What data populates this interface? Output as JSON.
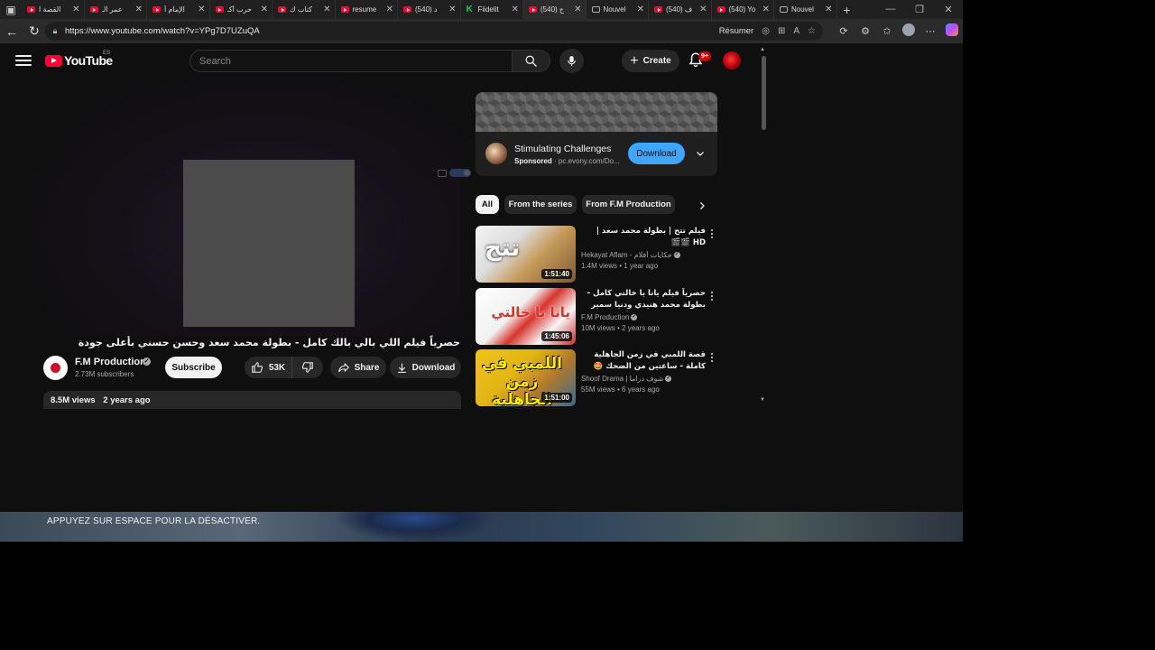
{
  "browser": {
    "tabs": [
      {
        "label": "القصة ا",
        "favicon": "youtube"
      },
      {
        "label": "عمر الـ",
        "favicon": "youtube"
      },
      {
        "label": "الإمام أ",
        "favicon": "youtube"
      },
      {
        "label": "حرب أكـ",
        "favicon": "youtube"
      },
      {
        "label": "كتاب ك",
        "favicon": "youtube"
      },
      {
        "label": "resume",
        "favicon": "youtube"
      },
      {
        "label": "(540) د",
        "favicon": "youtube"
      },
      {
        "label": "Fiidelit",
        "favicon": "k"
      },
      {
        "label": "(540) ح",
        "favicon": "youtube",
        "active": true
      },
      {
        "label": "Nouvel",
        "favicon": "page"
      },
      {
        "label": "(540) ف",
        "favicon": "youtube"
      },
      {
        "label": "(540) Yo",
        "favicon": "youtube"
      },
      {
        "label": "Nouvel",
        "favicon": "page"
      }
    ],
    "url": "https://www.youtube.com/watch?v=YPg7D7UZuQA",
    "resume_label": "Résumer"
  },
  "youtube": {
    "logo_text": "YouTube",
    "country_code": "ES",
    "search_placeholder": "Search",
    "create_label": "Create",
    "notification_count": "9+",
    "video": {
      "title": "حصرياً فيلم اللي بالي بالك كامل - بطولة محمد سعد وحسن حسني بأعلى جودة",
      "channel": "F.M Production",
      "subscribers": "2.73M subscribers",
      "subscribe_label": "Subscribe",
      "likes": "53K",
      "share_label": "Share",
      "download_label": "Download",
      "views": "8.5M views",
      "age": "2 years ago"
    },
    "ad": {
      "title": "Stimulating Challenges",
      "sponsored": "Sponsored",
      "domain": "pc.evony.com/Do...",
      "cta": "Download"
    },
    "chips": [
      "All",
      "From the series",
      "From F.M Production"
    ],
    "recommendations": [
      {
        "title": "فيلم تتح | بطولة محمد سعد | HD 🎬🎬",
        "channel": "Hekayat Aflam - حكايات أفلام",
        "views": "1.4M views",
        "age": "1 year ago",
        "duration": "1:51:40",
        "thumb_text": "تتح"
      },
      {
        "title": "حصرياً فيلم يانا يا خالتي كامل - بطولة محمد هنيدي ودنيا سمير غانم وحسن حسني بأعلى",
        "channel": "F.M Production",
        "views": "10M views",
        "age": "2 years ago",
        "duration": "1:45:06",
        "thumb_text": "يانا يا خالتي"
      },
      {
        "title": "قصة اللمبي في زمن الجاهلية كاملة - ساعتين من الضحك 🤩 محمد سعد - فيتا الطاغ",
        "channel": "Shoof Drama | شوف دراما",
        "views": "55M views",
        "age": "6 years ago",
        "duration": "1:51:00",
        "thumb_text": "اللمبي في زمن الجاهلية كامل"
      }
    ]
  },
  "overlay": {
    "hint": "APPUYEZ SUR ESPACE POUR LA DÉSACTIVER."
  },
  "colors": {
    "yt_red": "#ff0033",
    "accent_blue": "#3ea6ff",
    "page_bg": "#0f0f0f"
  }
}
